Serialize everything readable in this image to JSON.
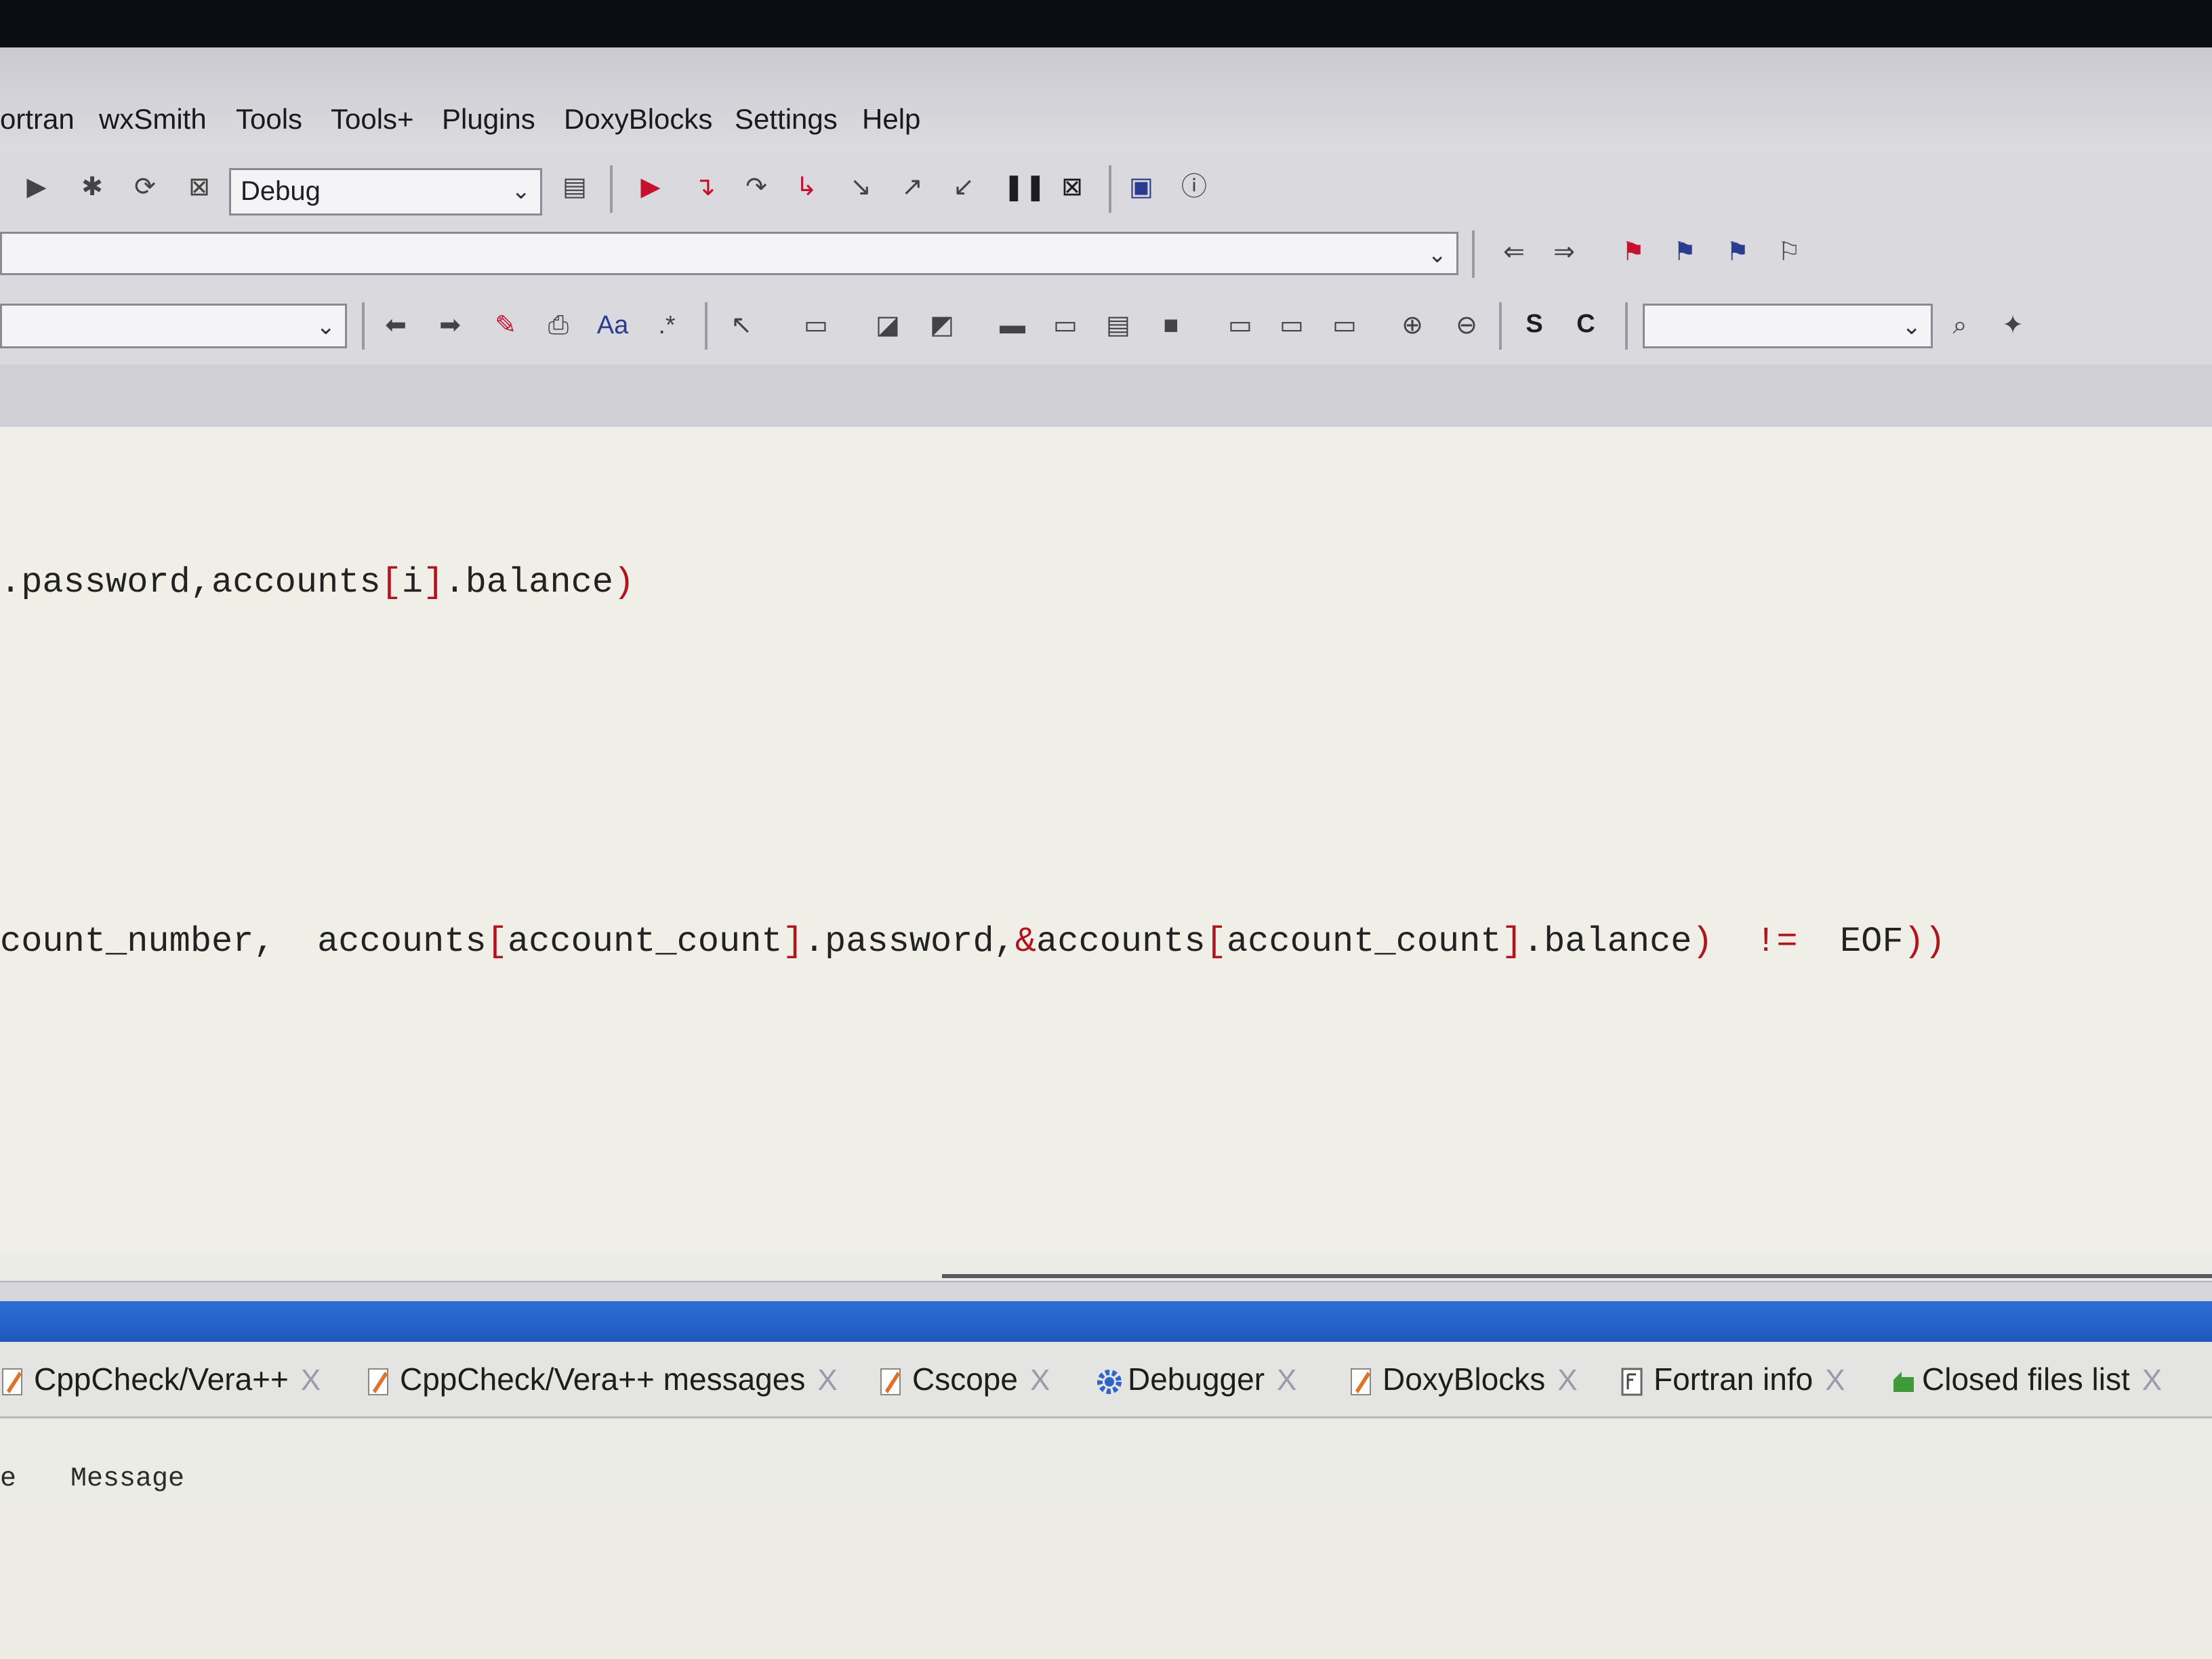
{
  "menu": {
    "items": [
      "ortran",
      "wxSmith",
      "Tools",
      "Tools+",
      "Plugins",
      "DoxyBlocks",
      "Settings",
      "Help"
    ]
  },
  "toolbar": {
    "build_target": "Debug",
    "bottom_letters": [
      "S",
      "C"
    ]
  },
  "editor": {
    "lines": [
      {
        "tokens": [
          {
            "t": "ident",
            "v": ".password,accounts"
          },
          {
            "t": "op",
            "v": "["
          },
          {
            "t": "ident",
            "v": "i"
          },
          {
            "t": "op",
            "v": "]"
          },
          {
            "t": "ident",
            "v": ".balance"
          },
          {
            "t": "op",
            "v": ")"
          }
        ]
      },
      {
        "tokens": [
          {
            "t": "ident",
            "v": "count_number,  accounts"
          },
          {
            "t": "op",
            "v": "["
          },
          {
            "t": "ident",
            "v": "account_count"
          },
          {
            "t": "op",
            "v": "]"
          },
          {
            "t": "ident",
            "v": ".password,"
          },
          {
            "t": "op",
            "v": "&"
          },
          {
            "t": "ident",
            "v": "accounts"
          },
          {
            "t": "op",
            "v": "["
          },
          {
            "t": "ident",
            "v": "account_count"
          },
          {
            "t": "op",
            "v": "]"
          },
          {
            "t": "ident",
            "v": ".balance"
          },
          {
            "t": "op",
            "v": ")  !=  "
          },
          {
            "t": "ident",
            "v": "EOF"
          },
          {
            "t": "op",
            "v": "))"
          }
        ]
      }
    ]
  },
  "logs": {
    "tabs": [
      {
        "label": "CppCheck/Vera++",
        "icon": "pencil-icon"
      },
      {
        "label": "CppCheck/Vera++ messages",
        "icon": "pencil-icon"
      },
      {
        "label": "Cscope",
        "icon": "pencil-icon"
      },
      {
        "label": "Debugger",
        "icon": "gear-icon"
      },
      {
        "label": "DoxyBlocks",
        "icon": "pencil-icon"
      },
      {
        "label": "Fortran info",
        "icon": "document-icon"
      },
      {
        "label": "Closed files list",
        "icon": "recycle-icon"
      }
    ],
    "close_glyph": "X",
    "columns": [
      "e",
      "Message"
    ]
  }
}
